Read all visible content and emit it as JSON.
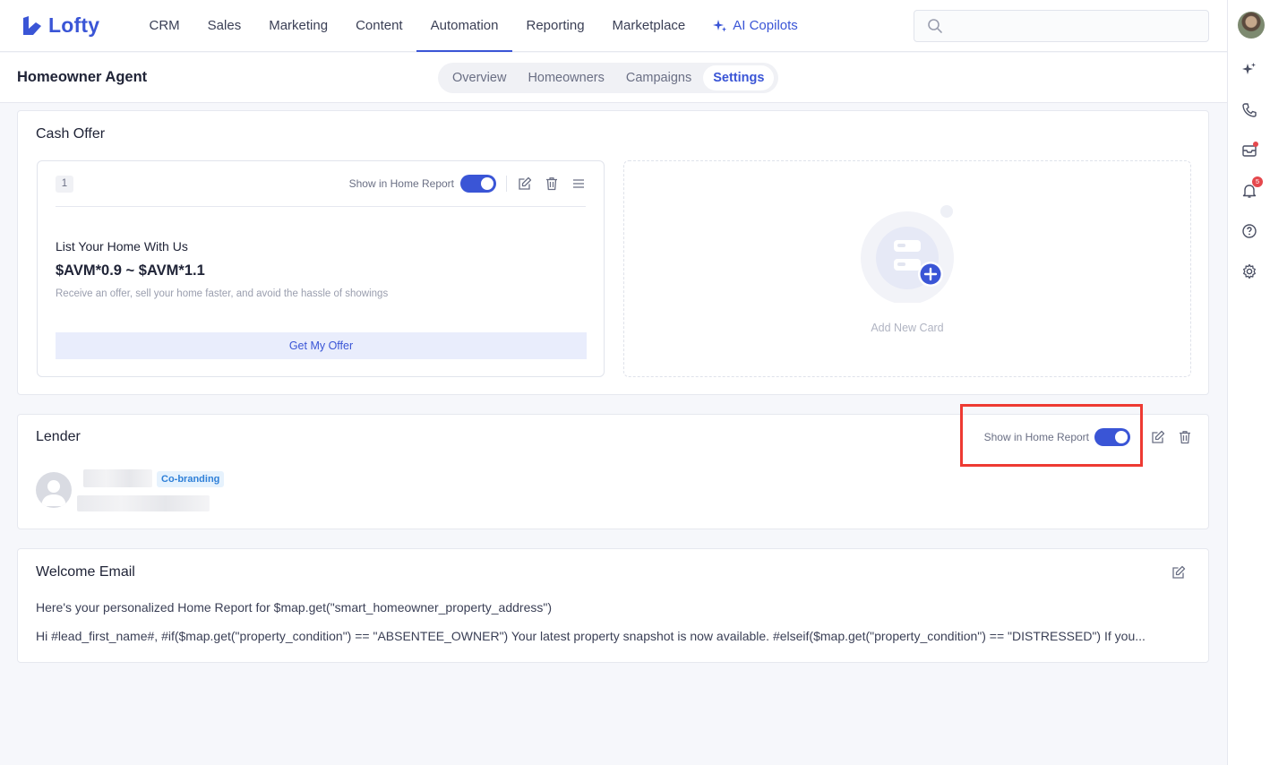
{
  "app": {
    "name": "Lofty",
    "brand_color": "#3a55d6"
  },
  "nav": {
    "items": [
      {
        "label": "CRM"
      },
      {
        "label": "Sales"
      },
      {
        "label": "Marketing"
      },
      {
        "label": "Content"
      },
      {
        "label": "Automation",
        "active": true
      },
      {
        "label": "Reporting"
      },
      {
        "label": "Marketplace"
      }
    ],
    "ai_label": "AI Copilots",
    "search_placeholder": ""
  },
  "rail": {
    "notification_count": "5"
  },
  "header": {
    "title": "Homeowner Agent",
    "tabs": [
      {
        "label": "Overview"
      },
      {
        "label": "Homeowners"
      },
      {
        "label": "Campaigns"
      },
      {
        "label": "Settings",
        "active": true
      }
    ]
  },
  "cash_offer": {
    "title": "Cash Offer",
    "card": {
      "index": "1",
      "show_label": "Show in Home Report",
      "show_enabled": true,
      "heading": "List Your Home With Us",
      "price": "$AVM*0.9 ~ $AVM*1.1",
      "description": "Receive an offer, sell your home faster, and avoid the hassle of showings",
      "button_label": "Get My Offer"
    },
    "add_card_label": "Add New Card"
  },
  "lender": {
    "title": "Lender",
    "show_label": "Show in Home Report",
    "show_enabled": true,
    "badge": "Co-branding"
  },
  "welcome_email": {
    "title": "Welcome Email",
    "subject": "Here's your personalized Home Report for $map.get(\"smart_homeowner_property_address\")",
    "body": "Hi #lead_first_name#, #if($map.get(\"property_condition\") == \"ABSENTEE_OWNER\") Your latest property snapshot is now available. #elseif($map.get(\"property_condition\") == \"DISTRESSED\") If you..."
  }
}
